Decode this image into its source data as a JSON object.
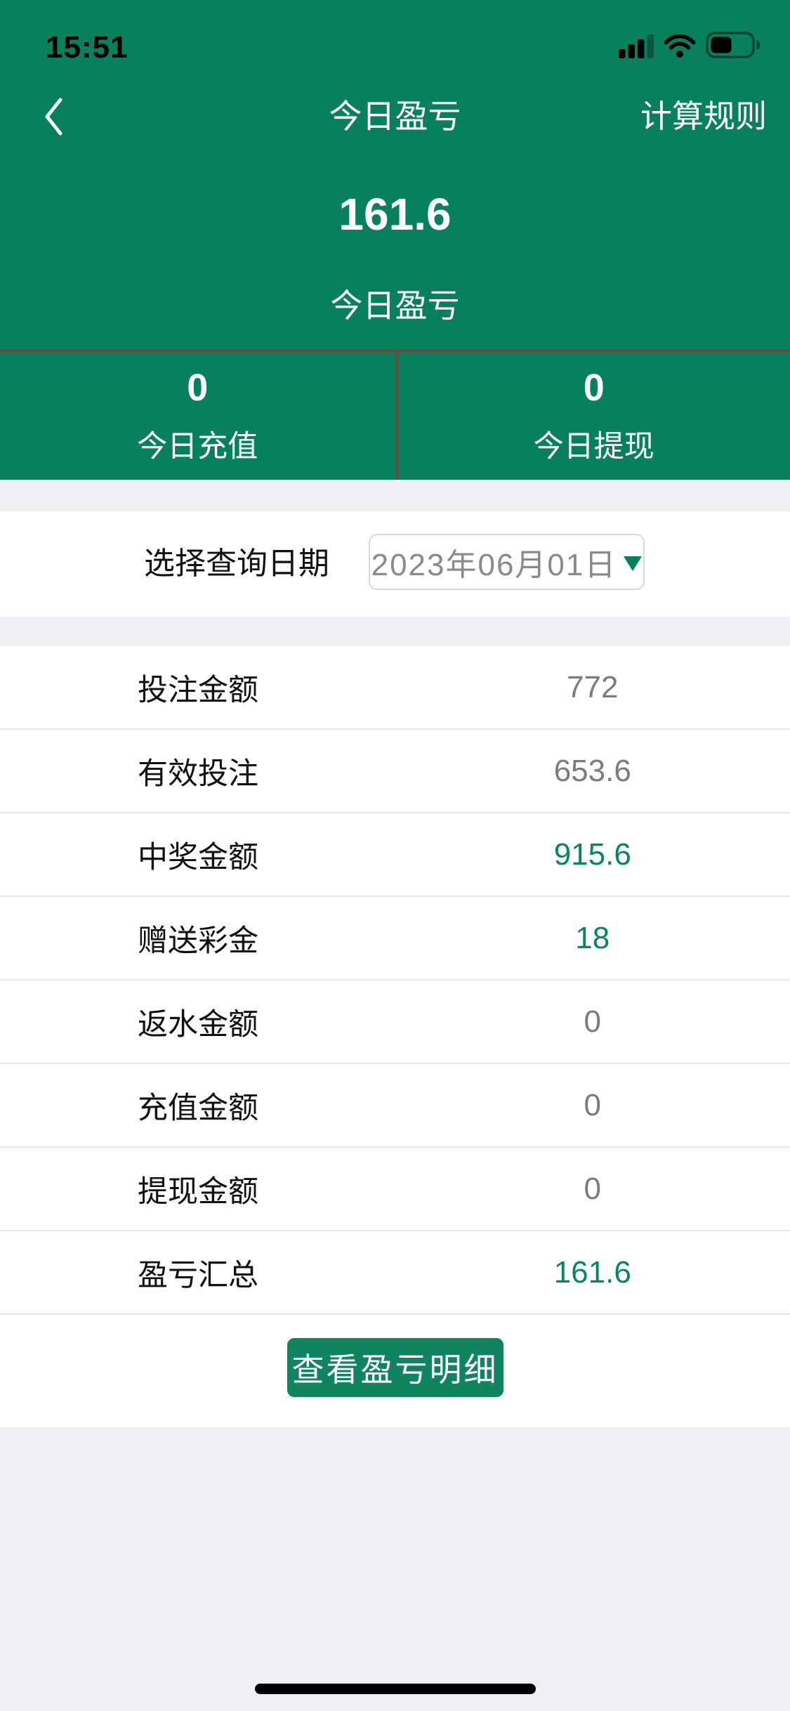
{
  "status_bar": {
    "time": "15:51",
    "icons": {
      "signal": "cellular-signal-3of4",
      "wifi": "wifi-full",
      "battery": "battery-about-half"
    }
  },
  "nav_bar": {
    "title": "今日盈亏",
    "rules_button": "计算规则"
  },
  "summary": {
    "profit_value": "161.6",
    "profit_label": "今日盈亏",
    "stats": [
      {
        "value": "0",
        "label": "今日充值"
      },
      {
        "value": "0",
        "label": "今日提现"
      }
    ]
  },
  "date_picker": {
    "label": "选择查询日期",
    "value": "2023年06月01日"
  },
  "table": {
    "rows": [
      {
        "label": "投注金额",
        "value": "772",
        "highlight": false
      },
      {
        "label": "有效投注",
        "value": "653.6",
        "highlight": false
      },
      {
        "label": "中奖金额",
        "value": "915.6",
        "highlight": true
      },
      {
        "label": "赠送彩金",
        "value": "18",
        "highlight": true
      },
      {
        "label": "返水金额",
        "value": "0",
        "highlight": false
      },
      {
        "label": "充值金额",
        "value": "0",
        "highlight": false
      },
      {
        "label": "提现金额",
        "value": "0",
        "highlight": false
      },
      {
        "label": "盈亏汇总",
        "value": "161.6",
        "highlight": true
      }
    ]
  },
  "actions": {
    "view_details_label": "查看盈亏明细"
  },
  "colors": {
    "theme_green": "#08805E",
    "button_green": "#10835F",
    "divider_brown": "#6A4B39",
    "value_gray": "#7C7C7C",
    "value_green": "#0A8563",
    "background_gray": "#EFEFF4"
  }
}
